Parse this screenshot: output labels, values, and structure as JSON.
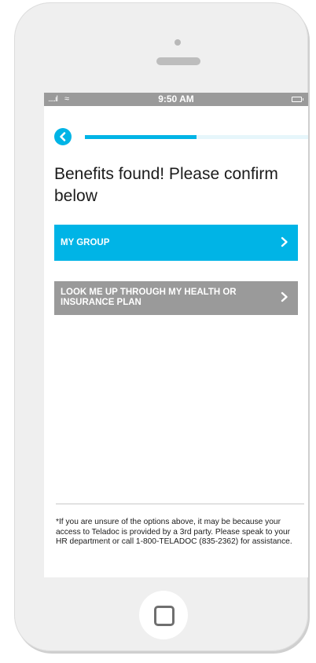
{
  "status_bar": {
    "signal": ".....ıl",
    "wifi": "≈",
    "time": "9:50 AM"
  },
  "progress": {
    "fraction": 0.5
  },
  "page": {
    "title": "Benefits found! Please confirm below"
  },
  "options": [
    {
      "label": "MY GROUP",
      "chevron": ">"
    },
    {
      "label": "LOOK ME UP THROUGH MY HEALTH OR INSURANCE PLAN",
      "chevron": ">"
    }
  ],
  "footnote": "*If you are unsure of the options above, it may be because your access to Teladoc is provided by a 3rd party. Please speak to your HR department or call 1-800-TELADOC (835-2362) for assistance.",
  "colors": {
    "accent": "#00b4e6",
    "secondary_button": "#9a9a9a",
    "status_bar": "#9a9a9a"
  },
  "icons": {
    "back": "chevron-left-icon",
    "option_arrow": "chevron-right-icon",
    "home": "home-button-icon"
  }
}
